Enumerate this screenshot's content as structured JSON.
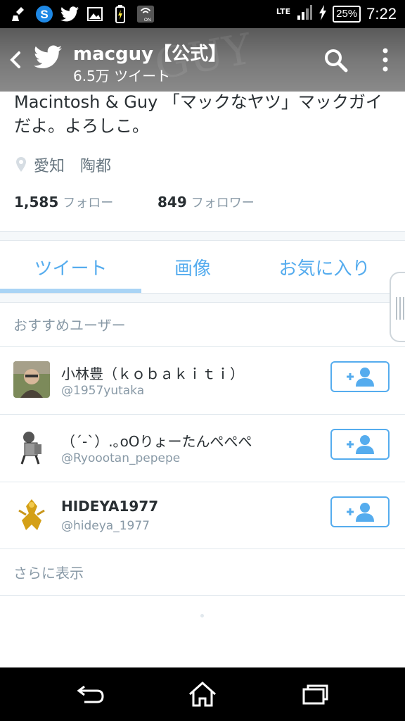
{
  "status_bar": {
    "network": "LTE",
    "battery": "25%",
    "time": "7:22",
    "left_icons": [
      "broom-icon",
      "sync-s-icon",
      "twitter-bird-icon",
      "image-icon",
      "battery-charging-icon",
      "nfc-on-icon"
    ]
  },
  "header": {
    "title": "macguy【公式】",
    "subtitle": "6.5万 ツイート"
  },
  "profile": {
    "bio": "Macintosh & Guy 「マックなヤツ」マックガイだよ。よろしこ。",
    "location": "愛知　陶都",
    "following_count": "1,585",
    "following_label": "フォロー",
    "followers_count": "849",
    "followers_label": "フォロワー"
  },
  "tabs": [
    {
      "label": "ツイート",
      "active": true
    },
    {
      "label": "画像",
      "active": false
    },
    {
      "label": "お気に入り",
      "active": false
    }
  ],
  "suggestions": {
    "title": "おすすめユーザー",
    "users": [
      {
        "name": "小林豊（ｋｏｂａｋｉｔｉ）",
        "handle": "@1957yutaka"
      },
      {
        "name": "（´-`）.｡oOりょーたんぺぺぺ",
        "handle": "@Ryoootan_pepepe"
      },
      {
        "name": "HIDEYA1977",
        "handle": "@hideya_1977"
      }
    ],
    "more_label": "さらに表示"
  },
  "colors": {
    "accent": "#55acee",
    "muted": "#8899a6",
    "text": "#292f33"
  }
}
